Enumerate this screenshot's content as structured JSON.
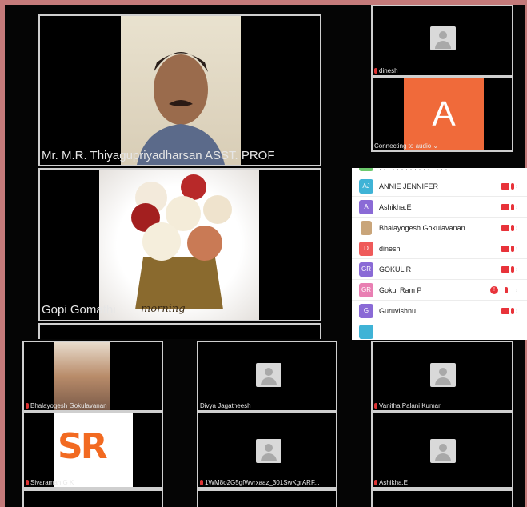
{
  "speaker": {
    "name": "Mr. M.R. Thiyagupriyadharsan ASST. PROF"
  },
  "second": {
    "name": "Gopi Gomathi",
    "overlay": "morning"
  },
  "right_tiles": [
    {
      "name": "dinesh"
    },
    {
      "initial": "A",
      "status": "Connecting to audio ⌄"
    }
  ],
  "participants": [
    {
      "initials": "AJ",
      "name": "ANNIE JENNIFER",
      "color": "#3fb3d6"
    },
    {
      "initials": "A",
      "name": "Ashikha.E",
      "color": "#8a6ad6"
    },
    {
      "initials": "",
      "name": "Bhalayogesh Gokulavanan",
      "color": "#c9a57a"
    },
    {
      "initials": "D",
      "name": "dinesh",
      "color": "#ef5a5a"
    },
    {
      "initials": "GR",
      "name": "GOKUL R",
      "color": "#8a6ad6"
    },
    {
      "initials": "GR",
      "name": "Gokul Ram P",
      "color": "#e97fb3"
    },
    {
      "initials": "G",
      "name": "Guruvishnu",
      "color": "#8a6ad6"
    }
  ],
  "gallery": [
    {
      "name": "Bhalayogesh Gokulavanan"
    },
    {
      "name": "Divya Jagatheesh"
    },
    {
      "name": "Vanitha Palani Kumar"
    },
    {
      "name": "Sivaraman G K"
    },
    {
      "name": "1WM8o2G5gfWvrxaaz_301SwKgrARF..."
    },
    {
      "name": "Ashikha.E"
    }
  ],
  "logo": {
    "text": "SR"
  }
}
